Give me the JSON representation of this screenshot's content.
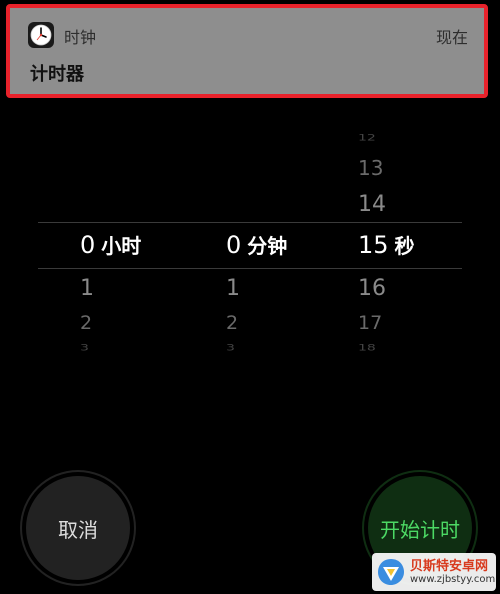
{
  "notification": {
    "app_icon": "clock-icon",
    "app_name": "时钟",
    "time": "现在",
    "title": "计时器"
  },
  "picker": {
    "hours": {
      "selected": "0",
      "unit": "小时",
      "below": [
        "1",
        "2",
        "3"
      ]
    },
    "minutes": {
      "selected": "0",
      "unit": "分钟",
      "below": [
        "1",
        "2",
        "3"
      ]
    },
    "seconds": {
      "selected": "15",
      "unit": "秒",
      "above": [
        "12",
        "13",
        "14"
      ],
      "below": [
        "16",
        "17",
        "18"
      ]
    }
  },
  "buttons": {
    "cancel": "取消",
    "start": "开始计时"
  },
  "watermark": {
    "brand": "贝斯特安卓网",
    "url": "www.zjbstyy.com"
  },
  "colors": {
    "banner_bg": "#8e8e8e",
    "highlight_border": "#e8222b",
    "start_green": "#4cd964",
    "start_bg": "#0f2e12",
    "cancel_bg": "#222222"
  }
}
